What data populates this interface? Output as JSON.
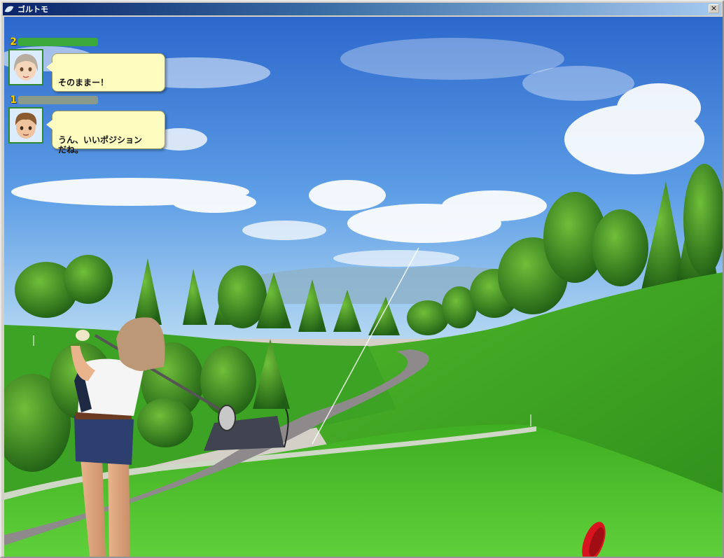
{
  "window": {
    "title": "ゴルトモ",
    "close_glyph": "×",
    "icon": "app-leaf-icon"
  },
  "chat": [
    {
      "player_number": "2",
      "name_bar_color": "#3aa83a",
      "avatar": "female-avatar-icon",
      "message": "そのままー！"
    },
    {
      "player_number": "1",
      "name_bar_color": "#8a9a8a",
      "avatar": "male-avatar-icon",
      "message": "うん、いいポジション\nだね。"
    }
  ],
  "colors": {
    "sky_top": "#2f6fd0",
    "sky_bottom": "#a9d3f2",
    "grass": "#4fc12d",
    "grass_dark": "#2f8f1e",
    "path": "#8f8a8a",
    "tee_marker": "#d8141e"
  }
}
